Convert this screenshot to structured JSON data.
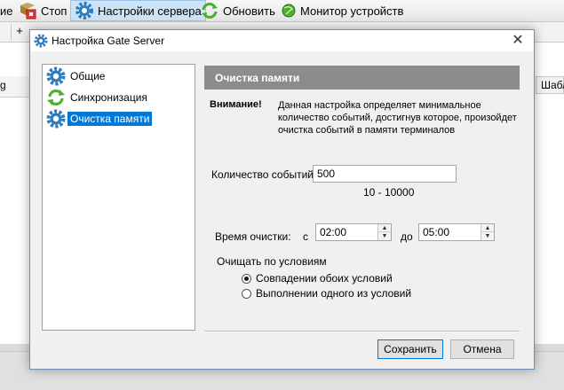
{
  "toolbar": {
    "items": [
      {
        "label": "ие"
      },
      {
        "label": "Стоп"
      },
      {
        "label": "Настройки сервера"
      },
      {
        "label": "Обновить"
      },
      {
        "label": "Монитор устройств"
      }
    ]
  },
  "background": {
    "left_column": "g",
    "right_column": "Шабл",
    "tab_add": "+"
  },
  "dialog": {
    "title": "Настройка Gate Server",
    "close_label": "✕",
    "nav": [
      {
        "label": "Общие",
        "icon": "gear-icon"
      },
      {
        "label": "Синхронизация",
        "icon": "sync-icon"
      },
      {
        "label": "Очистка памяти",
        "icon": "gear-icon",
        "selected": true
      }
    ],
    "panel_title": "Очистка памяти",
    "warning_label": "Внимание!",
    "warning_text": "Данная настройка определяет минимальное количество событий, достигнув которое, произойдет очистка событий в памяти терминалов",
    "events_label": "Количество событий:",
    "events_value": "500",
    "events_range": "10 - 10000",
    "time_label": "Время очистки:",
    "from_label": "с",
    "from_value": "02:00",
    "to_label": "до",
    "to_value": "05:00",
    "condition_label": "Очищать по условиям",
    "radio_both": "Совпадении обоих условий",
    "radio_any": "Выполнении одного из условий",
    "selected_radio": "both",
    "save_label": "Сохранить",
    "cancel_label": "Отмена"
  },
  "colors": {
    "accent": "#0078d7",
    "panel_header": "#8c8c8c",
    "gear": "#2e7bbd",
    "sync": "#4caf2e"
  }
}
